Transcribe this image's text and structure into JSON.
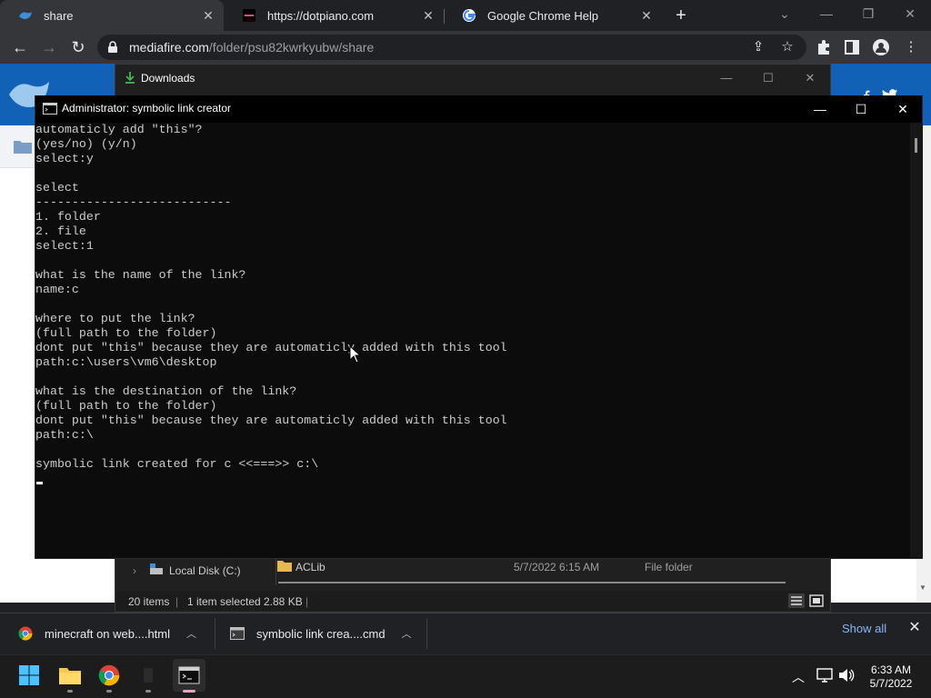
{
  "browser": {
    "tabs": [
      {
        "title": "share",
        "active": true
      },
      {
        "title": "https://dotpiano.com",
        "active": false
      },
      {
        "title": "Google Chrome Help",
        "active": false
      }
    ],
    "address": {
      "host": "mediafire.com",
      "path": "/folder/psu82kwrkyubw/share"
    },
    "colors": {
      "tabstrip": "#202124",
      "toolbar": "#35363a",
      "link": "#8ab4f8"
    }
  },
  "explorer": {
    "title": "Downloads",
    "sidebar_item": "Local Disk (C:)",
    "row": {
      "name": "ACLib",
      "date": "5/7/2022 6:15 AM",
      "type": "File folder"
    },
    "status": {
      "items": "20 items",
      "selected": "1 item selected",
      "size": "2.88 KB"
    }
  },
  "console": {
    "title": "Administrator:  symbolic link creator",
    "lines": [
      "automaticly add \"this\"?",
      "(yes/no) (y/n)",
      "select:y",
      "",
      "select",
      "---------------------------",
      "1. folder",
      "2. file",
      "select:1",
      "",
      "what is the name of the link?",
      "name:c",
      "",
      "where to put the link?",
      "(full path to the folder)",
      "dont put \"this\" because they are automaticly added with this tool",
      "path:c:\\users\\vm6\\desktop",
      "",
      "what is the destination of the link?",
      "(full path to the folder)",
      "dont put \"this\" because they are automaticly added with this tool",
      "path:c:\\",
      "",
      "symbolic link created for c <<===>> c:\\"
    ],
    "colors": {
      "background": "#0c0c0c",
      "text": "#cccccc"
    }
  },
  "downloads": {
    "items": [
      {
        "name": "minecraft on web....html",
        "icon": "chrome-icon"
      },
      {
        "name": "symbolic link crea....cmd",
        "icon": "cmd-file-icon"
      }
    ],
    "show_all": "Show all"
  },
  "taskbar": {
    "apps": [
      "start-icon",
      "file-explorer-icon",
      "chrome-icon",
      "app-icon",
      "terminal-icon"
    ],
    "time": "6:33 AM",
    "date": "5/7/2022"
  }
}
